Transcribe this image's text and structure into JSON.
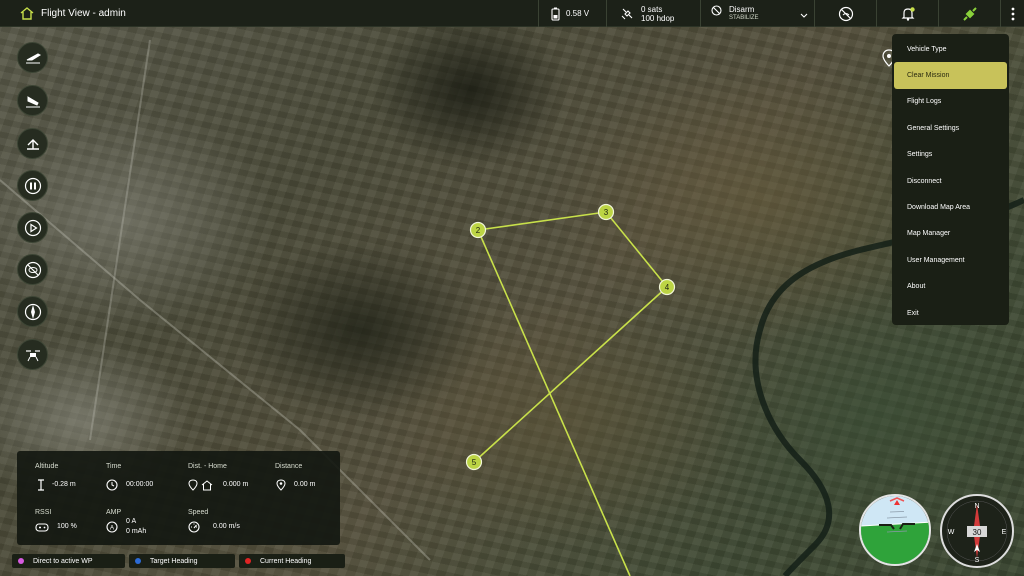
{
  "window": {
    "title": "Flight View - admin"
  },
  "status": {
    "battery": "0.58 V",
    "gps_sats": "0 sats",
    "gps_hdop": "100 hdop",
    "arm_state": "Disarm",
    "flight_mode": "STABILIZE"
  },
  "menu": {
    "items": [
      "Vehicle Type",
      "Clear Mission",
      "Flight Logs",
      "General Settings",
      "Settings",
      "Disconnect",
      "Download Map Area",
      "Map Manager",
      "User Management",
      "About",
      "Exit"
    ],
    "active_index": 1
  },
  "waypoints": [
    "2",
    "3",
    "4",
    "5"
  ],
  "telemetry": {
    "altitude": {
      "label": "Altitude",
      "value": "-0.28 m"
    },
    "time": {
      "label": "Time",
      "value": "00:00:00"
    },
    "dist_home": {
      "label": "Dist. - Home",
      "value": "0.000 m"
    },
    "distance": {
      "label": "Distance",
      "value": "0.00 m"
    },
    "rssi": {
      "label": "RSSI",
      "value": "100 %"
    },
    "amp": {
      "label": "AMP",
      "value_a": "0 A",
      "value_mah": "0 mAh"
    },
    "speed": {
      "label": "Speed",
      "value": "0.00 m/s"
    }
  },
  "legend": [
    {
      "label": "Direct to active WP",
      "color": "#d65be0"
    },
    {
      "label": "Target Heading",
      "color": "#2c6bd6"
    },
    {
      "label": "Current Heading",
      "color": "#e02424"
    }
  ],
  "compass": {
    "heading": "30",
    "N": "N",
    "E": "E",
    "S": "S",
    "W": "W"
  },
  "colors": {
    "accent": "#c8c25a",
    "path": "#c8e04a",
    "panel": "#1a1f15"
  },
  "icons": {
    "left_tools": [
      "takeoff-icon",
      "land-icon",
      "rtl-icon",
      "pause-icon",
      "play-icon",
      "no-gps-icon",
      "compass-calibrate-icon",
      "drone-icon"
    ],
    "top": [
      "home-icon",
      "battery-icon",
      "satellite-icon",
      "arm-icon",
      "no-signal-icon",
      "alert-bell-icon",
      "plug-connected-icon",
      "more-vert-icon"
    ]
  }
}
